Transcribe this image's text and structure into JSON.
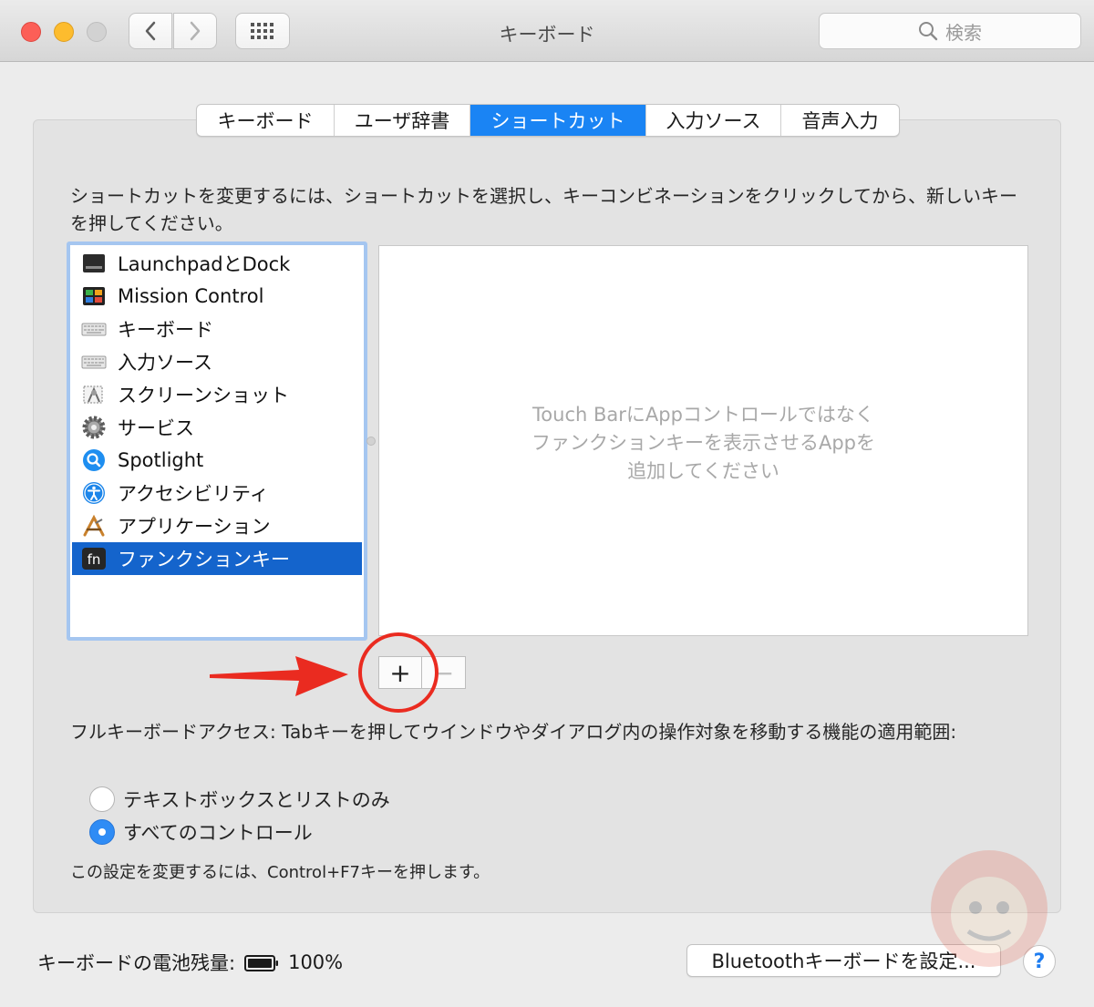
{
  "window": {
    "title": "キーボード"
  },
  "search": {
    "placeholder": "検索"
  },
  "tabs": [
    {
      "label": "キーボード",
      "active": false
    },
    {
      "label": "ユーザ辞書",
      "active": false
    },
    {
      "label": "ショートカット",
      "active": true
    },
    {
      "label": "入力ソース",
      "active": false
    },
    {
      "label": "音声入力",
      "active": false
    }
  ],
  "description": "ショートカットを変更するには、ショートカットを選択し、キーコンビネーションをクリックしてから、新しいキーを押してください。",
  "categories": [
    {
      "label": "LaunchpadとDock",
      "icon": "launchpad-icon"
    },
    {
      "label": "Mission Control",
      "icon": "mission-control-icon"
    },
    {
      "label": "キーボード",
      "icon": "keyboard-icon"
    },
    {
      "label": "入力ソース",
      "icon": "input-source-icon"
    },
    {
      "label": "スクリーンショット",
      "icon": "screenshot-icon"
    },
    {
      "label": "サービス",
      "icon": "gear-icon"
    },
    {
      "label": "Spotlight",
      "icon": "spotlight-icon"
    },
    {
      "label": "アクセシビリティ",
      "icon": "accessibility-icon"
    },
    {
      "label": "アプリケーション",
      "icon": "app-store-icon"
    },
    {
      "label": "ファンクションキー",
      "icon": "fn-key-icon",
      "selected": true
    }
  ],
  "detail": {
    "placeholder_line1": "Touch BarにAppコントロールではなく",
    "placeholder_line2": "ファンクションキーを表示させるAppを",
    "placeholder_line3": "追加してください"
  },
  "buttons": {
    "plus": "+",
    "minus": "−"
  },
  "full_keyboard_access": {
    "label": "フルキーボードアクセス: Tabキーを押してウインドウやダイアログ内の操作対象を移動する機能の適用範囲:",
    "options": [
      {
        "label": "テキストボックスとリストのみ",
        "selected": false
      },
      {
        "label": "すべてのコントロール",
        "selected": true
      }
    ],
    "hint": "この設定を変更するには、Control+F7キーを押します。"
  },
  "battery": {
    "label": "キーボードの電池残量:",
    "value": "100%",
    "level": 1.0
  },
  "bluetooth_button": {
    "label": "Bluetoothキーボードを設定..."
  },
  "help_button": {
    "label": "?"
  },
  "colors": {
    "accent": "#1a84f4",
    "selection": "#1464cc",
    "annotation": "#ea2b20"
  }
}
